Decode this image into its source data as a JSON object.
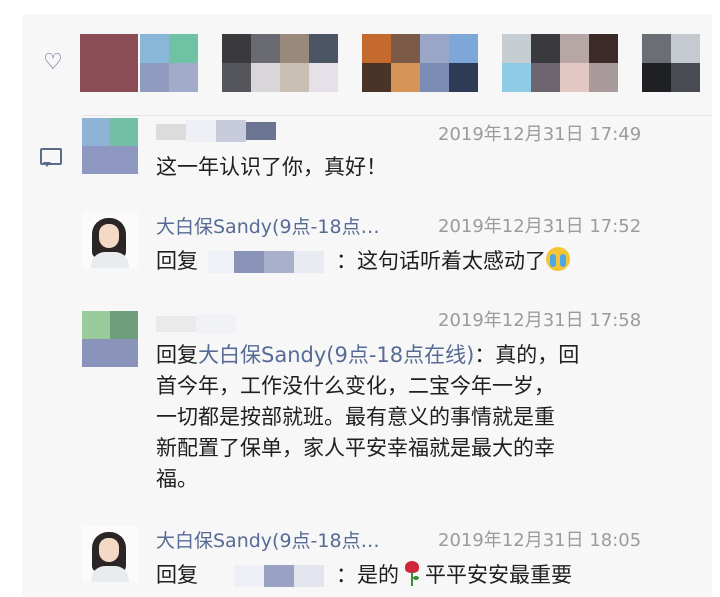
{
  "icons": {
    "like": "heart-icon",
    "comment": "comment-icon",
    "emoji_cry": "crying-face-emoji",
    "emoji_rose": "rose-emoji"
  },
  "colors": {
    "link": "#576b95",
    "timestamp": "#9b9b9b",
    "text": "#1f1f1f",
    "panel": "#f7f7f7"
  },
  "comments": [
    {
      "author": "",
      "time": "2019年12月31日 17:49",
      "text": "这一年认识了你，真好！"
    },
    {
      "author": "大白保Sandy(9点-18点…",
      "time": "2019年12月31日 17:52",
      "reply_prefix": "回复",
      "text": "：这句话听着太感动了"
    },
    {
      "author": "",
      "time": "2019年12月31日 17:58",
      "reply_prefix": "回复",
      "reply_to": "大白保Sandy(9点-18点在线)",
      "text_lines": [
        "：真的，回",
        "首今年，工作没什么变化，二宝今年一岁，",
        "一切都是按部就班。最有意义的事情就是重",
        "新配置了保单，家人平安幸福就是最大的幸",
        "福。"
      ]
    },
    {
      "author": "大白保Sandy(9点-18点…",
      "time": "2019年12月31日 18:05",
      "reply_prefix": "回复",
      "text_before": "：是的",
      "text_after": "平平安安最重要"
    }
  ]
}
